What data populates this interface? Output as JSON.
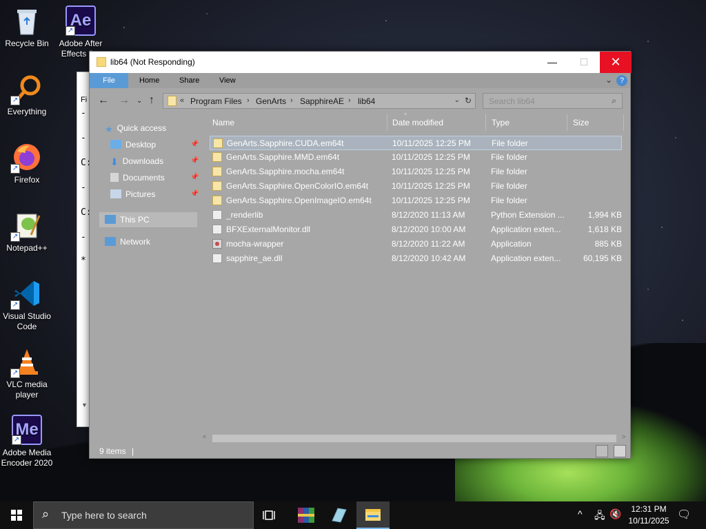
{
  "desktop": {
    "icons": [
      {
        "label": "Recycle Bin"
      },
      {
        "label": "Adobe After Effects 2..."
      },
      {
        "label": "Everything"
      },
      {
        "label": "Firefox"
      },
      {
        "label": "Notepad++"
      },
      {
        "label": "Visual Studio Code"
      },
      {
        "label": "VLC media player"
      },
      {
        "label": "Adobe Media Encoder 2020"
      }
    ],
    "ae_glyph": "Ae",
    "me_glyph": "Me"
  },
  "bg_window": {
    "title_fragment": "Fi",
    "lines": [
      "-",
      "-",
      "C:",
      "-",
      "C:",
      "-",
      "*"
    ]
  },
  "window": {
    "title": "lib64 (Not Responding)",
    "ribbon_tabs": [
      "File",
      "Home",
      "Share",
      "View"
    ],
    "breadcrumb": [
      "Program Files",
      "GenArts",
      "SapphireAE",
      "lib64"
    ],
    "search_placeholder": "Search lib64",
    "nav": {
      "quick_access": "Quick access",
      "items": [
        {
          "label": "Desktop",
          "pinned": true
        },
        {
          "label": "Downloads",
          "pinned": true
        },
        {
          "label": "Documents",
          "pinned": true
        },
        {
          "label": "Pictures",
          "pinned": true
        }
      ],
      "this_pc": "This PC",
      "network": "Network"
    },
    "columns": [
      "Name",
      "Date modified",
      "Type",
      "Size"
    ],
    "files": [
      {
        "name": "GenArts.Sapphire.CUDA.em64t",
        "date": "10/11/2025 12:25 PM",
        "type": "File folder",
        "size": "",
        "icon": "folder-icon"
      },
      {
        "name": "GenArts.Sapphire.MMD.em64t",
        "date": "10/11/2025 12:25 PM",
        "type": "File folder",
        "size": "",
        "icon": "folder-icon"
      },
      {
        "name": "GenArts.Sapphire.mocha.em64t",
        "date": "10/11/2025 12:25 PM",
        "type": "File folder",
        "size": "",
        "icon": "folder-icon"
      },
      {
        "name": "GenArts.Sapphire.OpenColorIO.em64t",
        "date": "10/11/2025 12:25 PM",
        "type": "File folder",
        "size": "",
        "icon": "folder-icon"
      },
      {
        "name": "GenArts.Sapphire.OpenImageIO.em64t",
        "date": "10/11/2025 12:25 PM",
        "type": "File folder",
        "size": "",
        "icon": "folder-icon"
      },
      {
        "name": "_renderlib",
        "date": "8/12/2020 11:13 AM",
        "type": "Python Extension ...",
        "size": "1,994 KB",
        "icon": "python-file-icon"
      },
      {
        "name": "BFXExternalMonitor.dll",
        "date": "8/12/2020 10:00 AM",
        "type": "Application exten...",
        "size": "1,618 KB",
        "icon": "dll-file-icon"
      },
      {
        "name": "mocha-wrapper",
        "date": "8/12/2020 11:22 AM",
        "type": "Application",
        "size": "885 KB",
        "icon": "application-icon"
      },
      {
        "name": "sapphire_ae.dll",
        "date": "8/12/2020 10:42 AM",
        "type": "Application exten...",
        "size": "60,195 KB",
        "icon": "dll-file-icon"
      }
    ],
    "status_count": "9 items"
  },
  "taskbar": {
    "search_placeholder": "Type here to search",
    "time": "12:31 PM",
    "date": "10/11/2025"
  },
  "colors": {
    "accent": "#5b9bd5",
    "close_button": "#e81123",
    "window_body": "#a7a7a7",
    "taskbar": "#101010"
  }
}
